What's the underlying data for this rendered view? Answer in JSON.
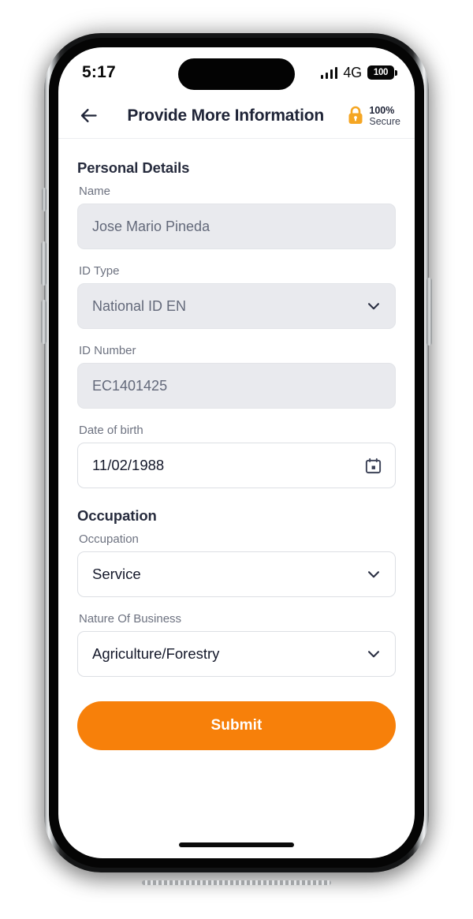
{
  "status_bar": {
    "time": "5:17",
    "network": "4G",
    "battery_level": "100",
    "signal_icon": "signal-bars-icon",
    "battery_icon": "battery-icon"
  },
  "header": {
    "back_icon": "arrow-left-icon",
    "title": "Provide More Information",
    "lock_icon": "lock-icon",
    "secure_percent": "100%",
    "secure_label": "Secure",
    "lock_color": "#F5A623"
  },
  "sections": {
    "personal_details": {
      "heading": "Personal Details",
      "fields": [
        {
          "label": "Name",
          "value": "Jose Mario Pineda",
          "type": "text",
          "state": "disabled",
          "name": "name-field"
        },
        {
          "label": "ID Type",
          "value": "National ID EN",
          "type": "select",
          "state": "disabled",
          "name": "id-type-select"
        },
        {
          "label": "ID Number",
          "value": "EC1401425",
          "type": "text",
          "state": "disabled",
          "name": "id-number-field"
        },
        {
          "label": "Date of birth",
          "value": "11/02/1988",
          "type": "date",
          "state": "active",
          "name": "date-of-birth-field"
        }
      ]
    },
    "occupation": {
      "heading": "Occupation",
      "fields": [
        {
          "label": "Occupation",
          "value": "Service",
          "type": "select",
          "state": "active",
          "name": "occupation-select"
        },
        {
          "label": "Nature Of Business",
          "value": "Agriculture/Forestry",
          "type": "select",
          "state": "active",
          "name": "nature-of-business-select"
        }
      ]
    }
  },
  "footer": {
    "submit_label": "Submit",
    "submit_color": "#F7800A"
  }
}
